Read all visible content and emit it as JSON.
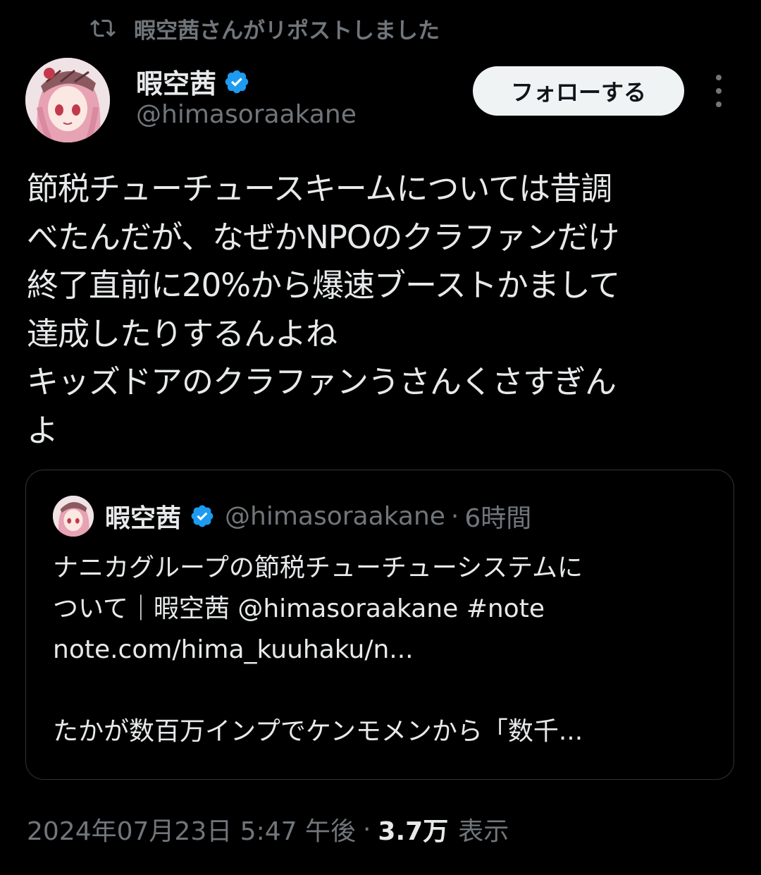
{
  "repost": {
    "text": "暇空茜さんがリポストしました",
    "icon": "repost-icon"
  },
  "tweet": {
    "author": {
      "name": "暇空茜",
      "handle": "@himasoraakane",
      "verified": true
    },
    "follow_label": "フォローする",
    "more_icon": "more-icon",
    "text": "節税チューチュースキームについては昔調\nべたんだが、なぜかNPOのクラファンだけ\n終了直前に20%から爆速ブーストかまして\n達成したりするんよね\nキッズドアのクラファンうさんくさすぎん\nよ",
    "quote": {
      "name": "暇空茜",
      "handle": "@himasoraakane",
      "separator": "·",
      "time": "6時間",
      "text": "ナニカグループの節税チューチューシステムに\nついて｜暇空茜 @himasoraakane #note\nnote.com/hima_kuuhaku/n...\n\nたかが数百万インプでケンモメンから「数千..."
    },
    "meta": {
      "timestamp": "2024年07月23日 5:47 午後",
      "separator": "·",
      "views_count": "3.7万",
      "views_label": "表示"
    }
  },
  "colors": {
    "background": "#000000",
    "text": "#e7e9ea",
    "secondary": "#71767b",
    "verified": "#1d9bf0",
    "border": "#2f3336"
  }
}
